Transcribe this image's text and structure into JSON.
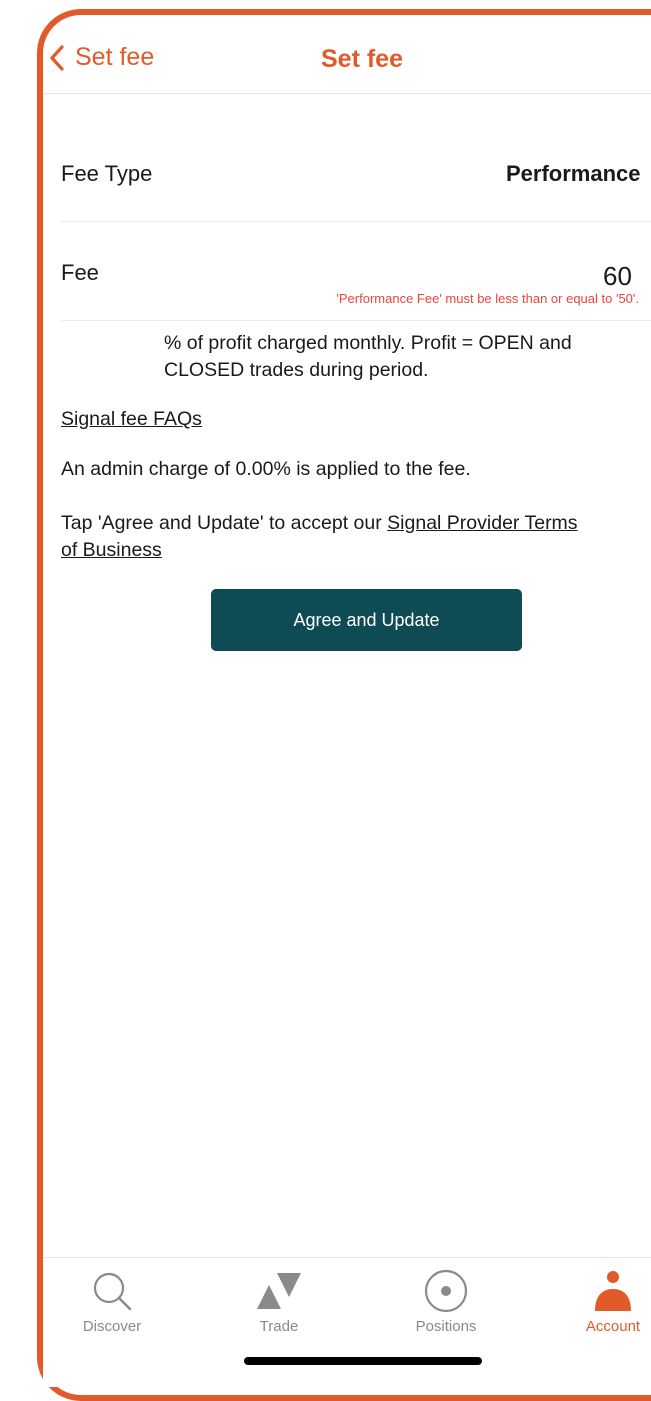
{
  "header": {
    "back_label": "Set fee",
    "title": "Set fee"
  },
  "fee_type": {
    "label": "Fee Type",
    "value": "Performance"
  },
  "fee": {
    "label": "Fee",
    "value": "60",
    "error": "'Performance Fee' must be less than or equal to '50'."
  },
  "description": "% of profit charged monthly. Profit = OPEN and CLOSED trades during period.",
  "faq_link": "Signal fee FAQs",
  "admin_charge": "An admin charge of 0.00% is applied to the fee.",
  "terms": {
    "prefix": "Tap 'Agree and Update' to accept our ",
    "link_part1": "Signal Provider Terms",
    "link_part2": "of Business"
  },
  "button_label": "Agree and Update",
  "tabs": [
    {
      "label": "Discover",
      "icon": "search-icon",
      "active": false
    },
    {
      "label": "Trade",
      "icon": "trade-icon",
      "active": false
    },
    {
      "label": "Positions",
      "icon": "positions-icon",
      "active": false
    },
    {
      "label": "Account",
      "icon": "account-icon",
      "active": true
    }
  ],
  "colors": {
    "accent": "#e35a2a",
    "button": "#0f4b55",
    "error": "#e8453c",
    "tab_inactive": "#8a8a8a"
  }
}
